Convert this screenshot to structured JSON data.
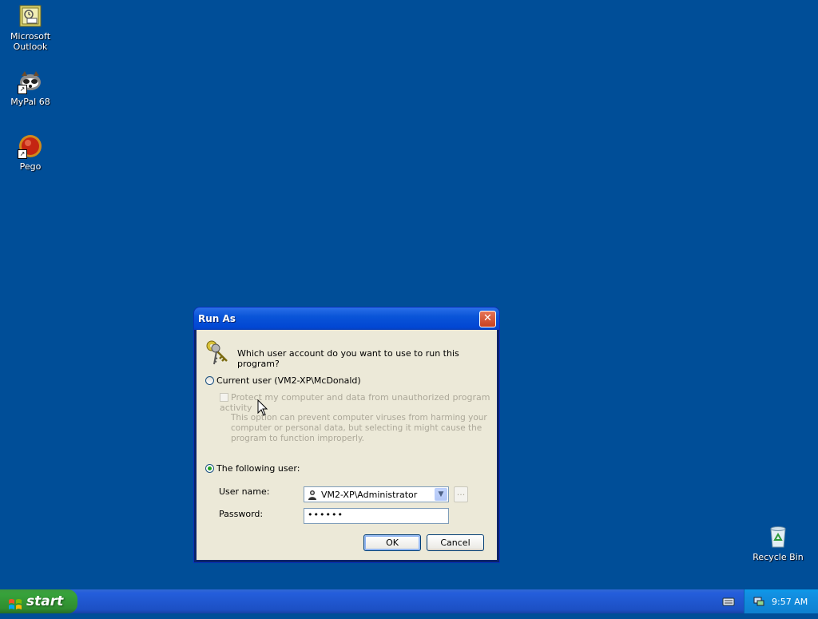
{
  "desktop": {
    "icons": [
      {
        "label": "Microsoft Outlook",
        "icon": "outlook-icon"
      },
      {
        "label": "MyPal 68",
        "icon": "mypal-icon"
      },
      {
        "label": "Pego",
        "icon": "pego-icon"
      },
      {
        "label": "Recycle Bin",
        "icon": "recycle-bin-icon"
      }
    ],
    "background_color": "#004e98"
  },
  "dialog": {
    "title": "Run As",
    "close_label": "✕",
    "prompt": "Which user account do you want to use to run this program?",
    "current_user": {
      "label": "Current user (VM2-XP\\McDonald)",
      "selected": false
    },
    "protect": {
      "label": "Protect my computer and data from unauthorized program activity",
      "checked": false,
      "disabled": true
    },
    "description": "This option can prevent computer viruses from harming your computer or personal data, but selecting it might cause the program to function improperly.",
    "following_user": {
      "label": "The following user:",
      "selected": true
    },
    "username_label": "User name:",
    "username_value": "VM2-XP\\Administrator",
    "browse_label": "...",
    "password_label": "Password:",
    "password_value": "••••••",
    "ok_label": "OK",
    "cancel_label": "Cancel"
  },
  "taskbar": {
    "start_label": "start",
    "clock": "9:57 AM"
  }
}
